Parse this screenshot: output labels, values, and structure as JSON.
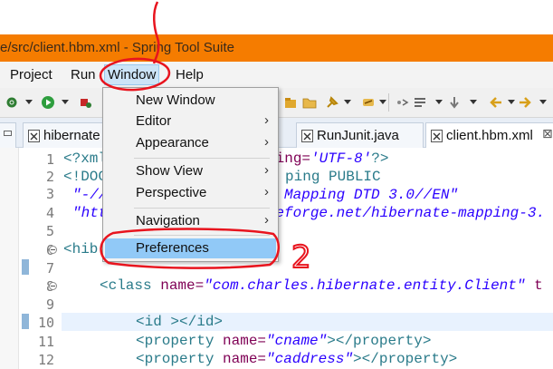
{
  "window": {
    "title": "e/src/client.hbm.xml - Spring Tool Suite"
  },
  "menubar": {
    "items": [
      "Project",
      "Run",
      "Window",
      "Help"
    ]
  },
  "tabs": [
    {
      "label": "hibernate",
      "close": ""
    },
    {
      "label": "RunJunit.java",
      "close": ""
    },
    {
      "label": "client.hbm.xml",
      "close": "⊠"
    }
  ],
  "window_menu": {
    "items": [
      {
        "label": "New Window",
        "arrow": ""
      },
      {
        "label": "Editor",
        "arrow": "›"
      },
      {
        "label": "Appearance",
        "arrow": "›"
      },
      {
        "label": "Show View",
        "arrow": "›"
      },
      {
        "label": "Perspective",
        "arrow": "›"
      },
      {
        "label": "Navigation",
        "arrow": "›"
      },
      {
        "label": "Preferences",
        "arrow": ""
      }
    ]
  },
  "editor": {
    "line_numbers": [
      "1",
      "2",
      "3",
      "4",
      "5",
      "6",
      "7",
      "8",
      "9",
      "10",
      "11",
      "12"
    ],
    "lines": {
      "l1a": "<?xml",
      "l1b": "ding=",
      "l1c": "'UTF-8'",
      "l1d": "?>",
      "l2a": "<!DOC",
      "l2b": "ping PUBLIC",
      "l3a": "\"-//",
      "l3b": " Mapping DTD 3.0//EN\"",
      "l4a": "\"htt",
      "l4b": "eforge.net/hibernate-mapping-3.",
      "l6a": "<hib",
      "l8a": "<class",
      "l8b": " name=",
      "l8c": "\"com.charles.hibernate.entity.Client\"",
      "l8d": " t",
      "l10a": "<id ></id>",
      "l11a": "<property",
      "l11b": " name=",
      "l11c": "\"cname\"",
      "l11d": "></property>",
      "l12a": "<property",
      "l12b": " name=",
      "l12c": "\"caddress\"",
      "l12d": "></property>"
    }
  },
  "annotation": {
    "number": "2",
    "color": "#e8141e"
  }
}
